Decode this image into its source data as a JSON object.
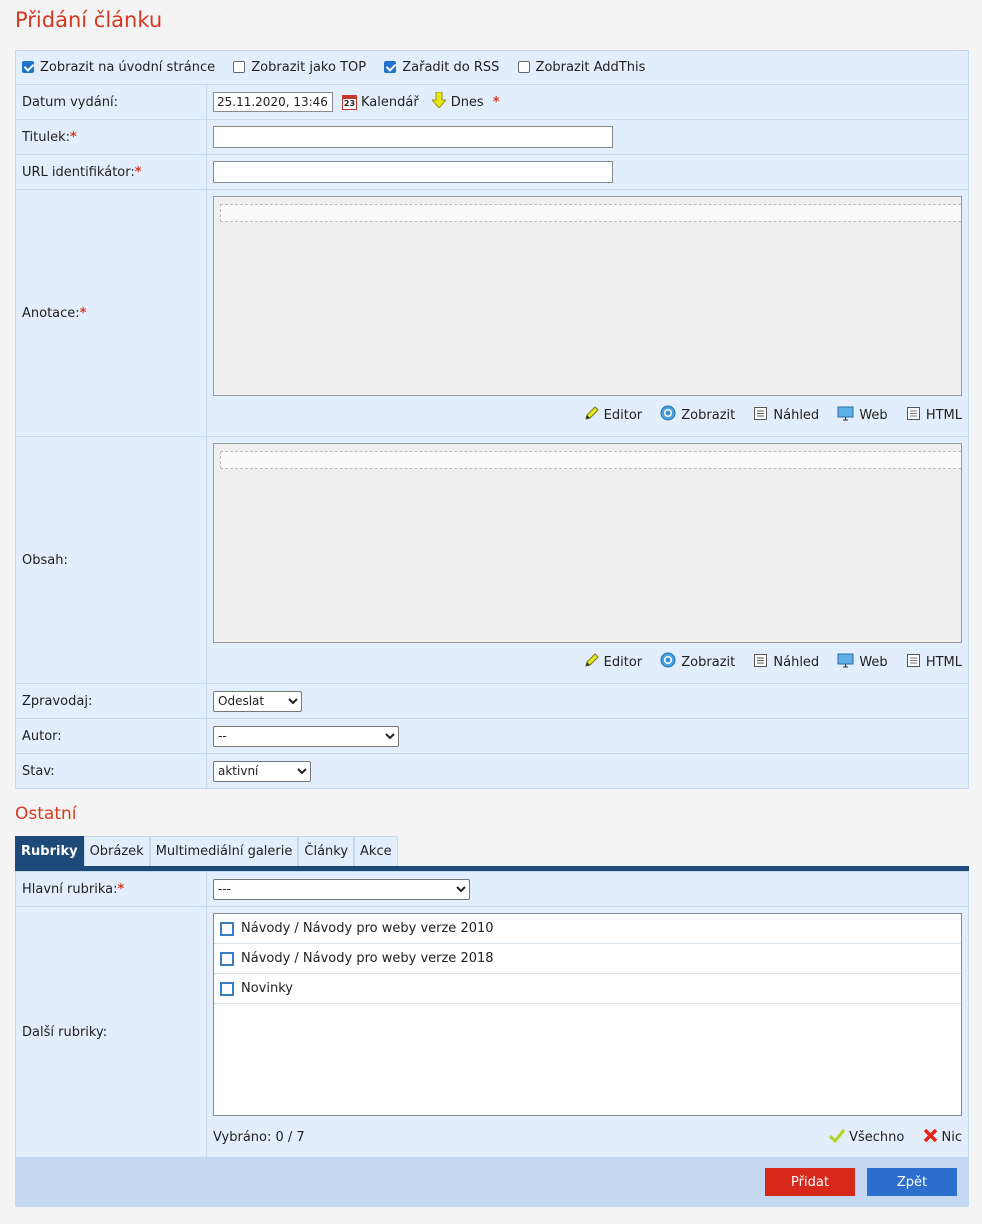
{
  "page": {
    "title": "Přidání článku",
    "section2_title": "Ostatní"
  },
  "flags": [
    {
      "label": "Zobrazit na úvodní stránce",
      "checked": true
    },
    {
      "label": "Zobrazit jako TOP",
      "checked": false
    },
    {
      "label": "Zařadit do RSS",
      "checked": true
    },
    {
      "label": "Zobrazit AddThis",
      "checked": false
    }
  ],
  "date": {
    "label": "Datum vydání:",
    "value": "25.11.2020, 13:46",
    "calendar_day": "23",
    "calendar_label": "Kalendář",
    "today_label": "Dnes"
  },
  "title_field": {
    "label": "Titulek:",
    "value": ""
  },
  "url_field": {
    "label": "URL identifikátor:",
    "value": ""
  },
  "annotation": {
    "label": "Anotace:"
  },
  "content": {
    "label": "Obsah:"
  },
  "editor_tools": {
    "editor": "Editor",
    "show": "Zobrazit",
    "preview": "Náhled",
    "web": "Web",
    "html": "HTML"
  },
  "reporter": {
    "label": "Zpravodaj:",
    "selected": "Odeslat"
  },
  "author": {
    "label": "Autor:",
    "selected": "--"
  },
  "state": {
    "label": "Stav:",
    "selected": "aktivní"
  },
  "tabs": [
    "Rubriky",
    "Obrázek",
    "Multimediální galerie",
    "Články",
    "Akce"
  ],
  "main_category": {
    "label": "Hlavní rubrika:",
    "selected": "---"
  },
  "other_categories": {
    "label": "Další rubriky:",
    "items": [
      "Návody / Návody pro weby verze 2010",
      "Návody / Návody pro weby verze 2018",
      "Novinky"
    ],
    "selected_text": "Vybráno: 0 / 7",
    "all_label": "Všechno",
    "none_label": "Nic"
  },
  "buttons": {
    "add": "Přidat",
    "back": "Zpět"
  },
  "colors": {
    "heading": "#d6381f",
    "row_bg": "#e2eefb",
    "tab_active": "#1d4a78",
    "btn_add": "#d8271b",
    "btn_back": "#2c6ecb"
  }
}
